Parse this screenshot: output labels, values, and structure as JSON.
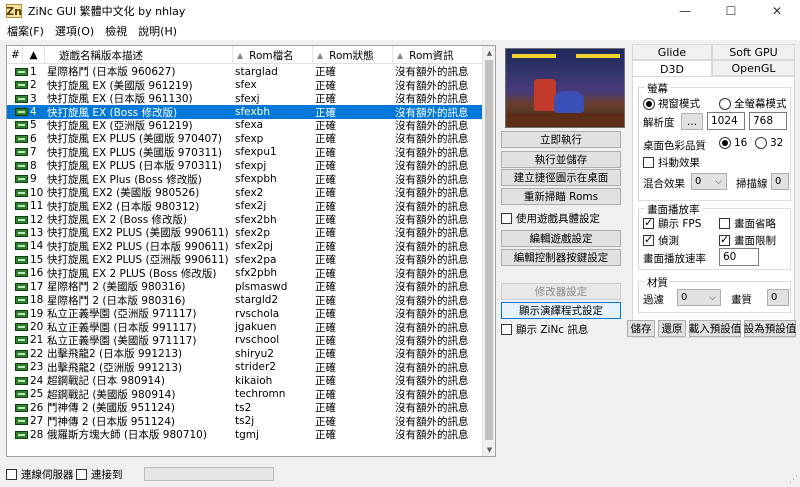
{
  "window": {
    "title": "ZiNc GUI  繁體中文化 by nhlay",
    "app_icon": "Zn",
    "minimize": "—",
    "maximize": "☐",
    "close": "✕"
  },
  "menu": [
    "檔案(F)",
    "選項(O)",
    "檢視",
    "說明(H)"
  ],
  "list": {
    "headers": [
      "#",
      "▲",
      "遊戲名稱版本描述",
      "Rom檔名",
      "Rom狀態",
      "Rom資訊"
    ],
    "rows": [
      {
        "n": "1",
        "name": "星際格鬥 (日本版 960627)",
        "file": "starglad",
        "status": "正確",
        "info": "沒有額外的訊息"
      },
      {
        "n": "2",
        "name": "快打旋風 EX (美國版 961219)",
        "file": "sfex",
        "status": "正確",
        "info": "沒有額外的訊息"
      },
      {
        "n": "3",
        "name": "快打旋風 EX (日本版 961130)",
        "file": "sfexj",
        "status": "正確",
        "info": "沒有額外的訊息"
      },
      {
        "n": "4",
        "name": "快打旋風 EX (Boss 修改版)",
        "file": "sfexbh",
        "status": "正確",
        "info": "沒有額外的訊息"
      },
      {
        "n": "5",
        "name": "快打旋風 EX (亞洲版 961219)",
        "file": "sfexa",
        "status": "正確",
        "info": "沒有額外的訊息"
      },
      {
        "n": "6",
        "name": "快打旋風 EX PLUS (美國版 970407)",
        "file": "sfexp",
        "status": "正確",
        "info": "沒有額外的訊息"
      },
      {
        "n": "7",
        "name": "快打旋風 EX PLUS (美國版 970311)",
        "file": "sfexpu1",
        "status": "正確",
        "info": "沒有額外的訊息"
      },
      {
        "n": "8",
        "name": "快打旋風 EX PLUS (日本版 970311)",
        "file": "sfexpj",
        "status": "正確",
        "info": "沒有額外的訊息"
      },
      {
        "n": "9",
        "name": "快打旋風 EX Plus (Boss 修改版)",
        "file": "sfexpbh",
        "status": "正確",
        "info": "沒有額外的訊息"
      },
      {
        "n": "10",
        "name": "快打旋風 EX2 (美國版 980526)",
        "file": "sfex2",
        "status": "正確",
        "info": "沒有額外的訊息"
      },
      {
        "n": "11",
        "name": "快打旋風 EX2 (日本版 980312)",
        "file": "sfex2j",
        "status": "正確",
        "info": "沒有額外的訊息"
      },
      {
        "n": "12",
        "name": "快打旋風 EX 2 (Boss 修改版)",
        "file": "sfex2bh",
        "status": "正確",
        "info": "沒有額外的訊息"
      },
      {
        "n": "13",
        "name": "快打旋風 EX2 PLUS (美國版 990611)",
        "file": "sfex2p",
        "status": "正確",
        "info": "沒有額外的訊息"
      },
      {
        "n": "14",
        "name": "快打旋風 EX2 PLUS (日本版 990611)",
        "file": "sfex2pj",
        "status": "正確",
        "info": "沒有額外的訊息"
      },
      {
        "n": "15",
        "name": "快打旋風 EX2 PLUS (亞洲版 990611)",
        "file": "sfex2pa",
        "status": "正確",
        "info": "沒有額外的訊息"
      },
      {
        "n": "16",
        "name": "快打旋風 EX 2 PLUS (Boss 修改版)",
        "file": "sfx2pbh",
        "status": "正確",
        "info": "沒有額外的訊息"
      },
      {
        "n": "17",
        "name": "星際格鬥 2 (美國版 980316)",
        "file": "plsmaswd",
        "status": "正確",
        "info": "沒有額外的訊息"
      },
      {
        "n": "18",
        "name": "星際格鬥 2 (日本版 980316)",
        "file": "stargld2",
        "status": "正確",
        "info": "沒有額外的訊息"
      },
      {
        "n": "19",
        "name": "私立正義學園 (亞洲版 971117)",
        "file": "rvschola",
        "status": "正確",
        "info": "沒有額外的訊息"
      },
      {
        "n": "20",
        "name": "私立正義學園 (日本版 991117)",
        "file": "jgakuen",
        "status": "正確",
        "info": "沒有額外的訊息"
      },
      {
        "n": "21",
        "name": "私立正義學園 (美國版 971117)",
        "file": "rvschool",
        "status": "正確",
        "info": "沒有額外的訊息"
      },
      {
        "n": "22",
        "name": "出擊飛龍2 (日本版 991213)",
        "file": "shiryu2",
        "status": "正確",
        "info": "沒有額外的訊息"
      },
      {
        "n": "23",
        "name": "出擊飛龍2 (亞洲版 991213)",
        "file": "strider2",
        "status": "正確",
        "info": "沒有額外的訊息"
      },
      {
        "n": "24",
        "name": "超鋼戰記 (日本 980914)",
        "file": "kikaioh",
        "status": "正確",
        "info": "沒有額外的訊息"
      },
      {
        "n": "25",
        "name": "超鋼戰記 (美國版 980914)",
        "file": "techromn",
        "status": "正確",
        "info": "沒有額外的訊息"
      },
      {
        "n": "26",
        "name": "鬥神傳 2 (美國版 951124)",
        "file": "ts2",
        "status": "正確",
        "info": "沒有額外的訊息"
      },
      {
        "n": "27",
        "name": "鬥神傳 2 (日本版 951124)",
        "file": "ts2j",
        "status": "正確",
        "info": "沒有額外的訊息"
      },
      {
        "n": "28",
        "name": "俄羅斯方塊大師 (日本版 980710)",
        "file": "tgmj",
        "status": "正確",
        "info": "沒有額外的訊息"
      }
    ],
    "selected_index": 3
  },
  "buttons": {
    "run_now": "立即執行",
    "run_and_save": "執行並儲存",
    "create_shortcut": "建立捷徑圖示在桌面",
    "rescan_roms": "重新掃瞄 Roms",
    "use_game_settings": "使用遊戲具體設定",
    "edit_game_settings": "編輯遊戲設定",
    "edit_controller_keys": "編輯控制器按鍵設定",
    "modifier_settings": "修改器設定",
    "show_renderer_settings": "顯示演繹程式設定",
    "show_zinc_info": "顯示 ZiNc 訊息"
  },
  "tabs": {
    "row1": [
      "Glide",
      "Soft GPU"
    ],
    "row2": [
      "D3D",
      "OpenGL"
    ],
    "active": "D3D"
  },
  "d3d": {
    "screen_group": "螢幕",
    "windowed": "視窗模式",
    "fullscreen": "全螢幕模式",
    "resolution_label": "解析度",
    "resolution_btn": "...",
    "res_w": "1024",
    "res_h": "768",
    "color_depth_label": "桌面色彩品質",
    "depth16": "16",
    "depth32": "32",
    "shake_effect": "抖動效果",
    "blend_label": "混合效果",
    "blend_value": "0",
    "scanline_label": "掃描線",
    "scanline_value": "0",
    "framerate_group": "畫面播放率",
    "show_fps": "顯示 FPS",
    "frame_skip": "畫面省略",
    "detect": "偵測",
    "frame_limit": "畫面限制",
    "framerate_label": "畫面播放速率",
    "framerate_value": "60",
    "material_group": "材質",
    "filter_label": "過濾",
    "filter_value": "0",
    "quality_label": "畫質",
    "quality_value": "0",
    "save": "儲存",
    "restore": "還原",
    "load_defaults": "載入預設值",
    "set_defaults": "設為預設值"
  },
  "status": {
    "connect_server": "連線伺服器",
    "connect_to": "連接到"
  },
  "icons": {
    "rom_icon": "chip-icon",
    "sort_icon": "sort-caret-icon"
  }
}
